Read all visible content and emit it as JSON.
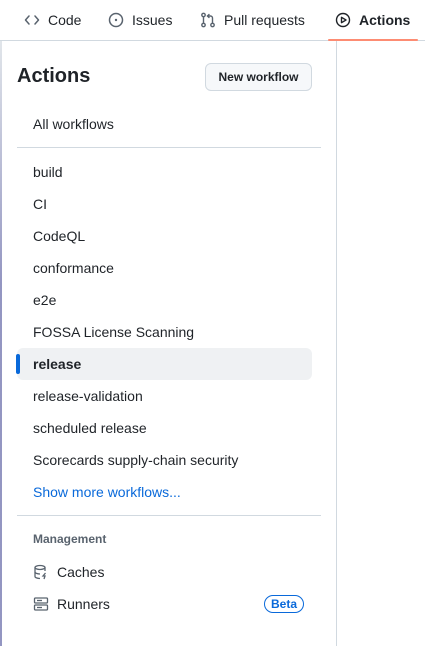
{
  "tabs": [
    {
      "label": "Code",
      "icon": "code-icon"
    },
    {
      "label": "Issues",
      "icon": "issue-opened-icon"
    },
    {
      "label": "Pull requests",
      "icon": "git-pull-request-icon"
    },
    {
      "label": "Actions",
      "icon": "play-icon",
      "selected": true
    }
  ],
  "sidebar": {
    "title": "Actions",
    "new_workflow_label": "New workflow",
    "all_workflows_label": "All workflows",
    "workflows": [
      "build",
      "CI",
      "CodeQL",
      "conformance",
      "e2e",
      "FOSSA License Scanning",
      "release",
      "release-validation",
      "scheduled release",
      "Scorecards supply-chain security"
    ],
    "active_workflow": "release",
    "show_more_label": "Show more workflows...",
    "management": {
      "header": "Management",
      "caches_label": "Caches",
      "runners_label": "Runners",
      "runners_badge": "Beta"
    }
  },
  "colors": {
    "accent": "#0969da",
    "tab_underline": "#fd8c73",
    "active_bg": "#eff1f3"
  }
}
